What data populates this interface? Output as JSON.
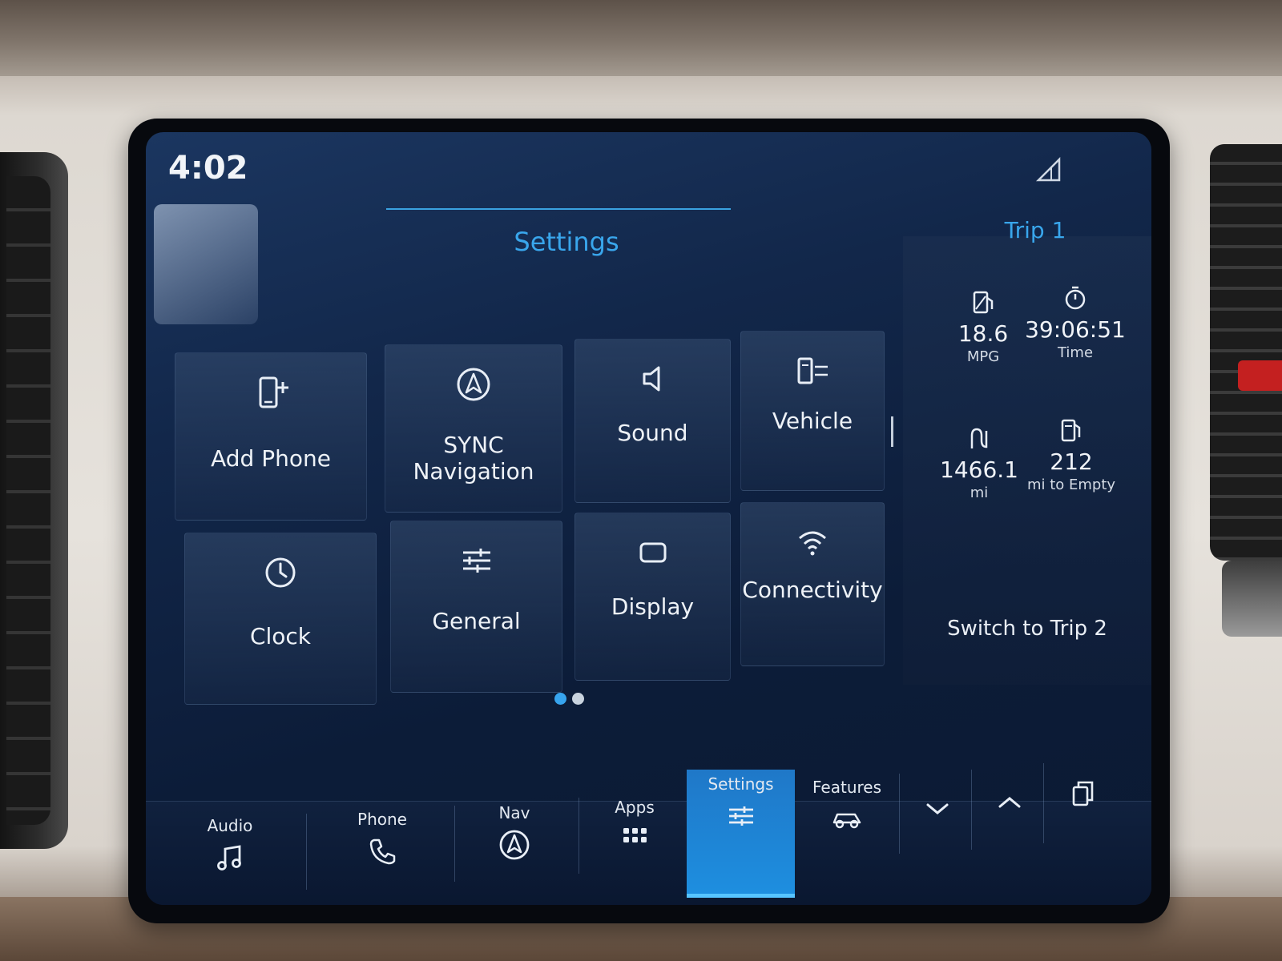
{
  "status": {
    "time": "4:02",
    "signal_icon": "signal-strength-icon"
  },
  "header": {
    "title": "Settings"
  },
  "tiles": [
    {
      "label": "Add Phone",
      "icon": "add-phone-icon"
    },
    {
      "label": "SYNC Navigation",
      "icon": "navigation-icon"
    },
    {
      "label": "Sound",
      "icon": "speaker-icon"
    },
    {
      "label": "Vehicle",
      "icon": "vehicle-icon"
    },
    {
      "label": "Clock",
      "icon": "clock-icon"
    },
    {
      "label": "General",
      "icon": "sliders-icon"
    },
    {
      "label": "Display",
      "icon": "display-icon"
    },
    {
      "label": "Connectivity",
      "icon": "wifi-icon"
    }
  ],
  "pagination": {
    "total": 2,
    "current": 1
  },
  "trip": {
    "title": "Trip 1",
    "stats": [
      {
        "value": "18.6",
        "unit": "MPG",
        "icon": "fuel-economy-icon"
      },
      {
        "value": "39:06:51",
        "unit": "Time",
        "icon": "stopwatch-icon"
      },
      {
        "value": "1466.1",
        "unit": "mi",
        "icon": "distance-icon"
      },
      {
        "value": "212",
        "unit": "mi to Empty",
        "icon": "fuel-pump-icon"
      }
    ],
    "switch_label": "Switch to Trip 2"
  },
  "nav": {
    "items": [
      {
        "label": "Audio",
        "icon": "music-note-icon"
      },
      {
        "label": "Phone",
        "icon": "phone-icon"
      },
      {
        "label": "Nav",
        "icon": "navigation-icon"
      },
      {
        "label": "Apps",
        "icon": "apps-grid-icon"
      },
      {
        "label": "Settings",
        "icon": "settings-sliders-icon",
        "active": true
      },
      {
        "label": "Features",
        "icon": "vehicle-features-icon"
      }
    ],
    "controls": [
      "chevron-down-icon",
      "chevron-up-icon",
      "copy-icon"
    ]
  },
  "colors": {
    "accent": "#39a6ec",
    "screen_bg": "#12274a",
    "active_tab": "#1e8fe0"
  }
}
